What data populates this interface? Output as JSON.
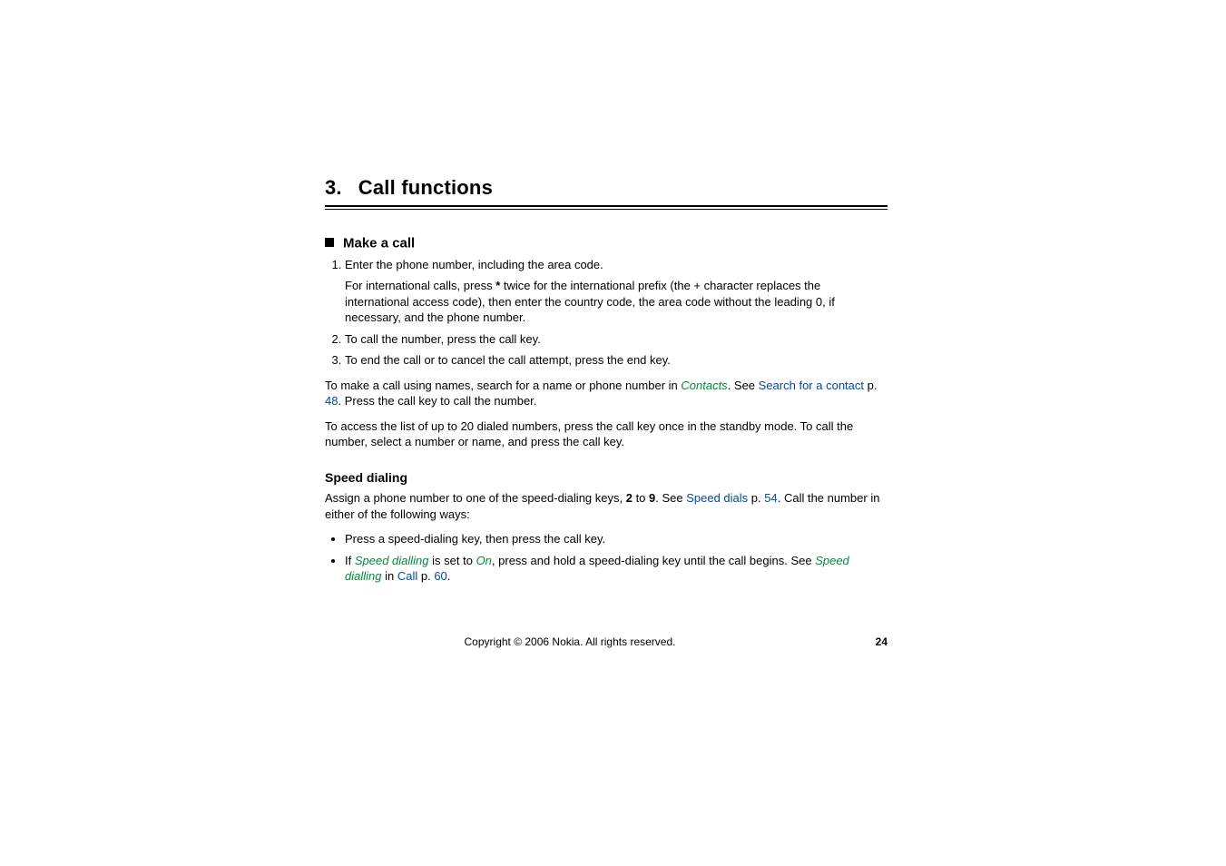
{
  "chapter": {
    "number": "3.",
    "title": "Call functions"
  },
  "section": {
    "title": "Make a call",
    "steps": [
      {
        "text": "Enter the phone number, including the area code.",
        "sub": "For international calls, press <span class='bold'>*</span> twice for the international prefix (the + character replaces the international access code), then enter the country code, the area code without the leading 0, if necessary, and the phone number."
      },
      {
        "text": "To call the number, press the call key."
      },
      {
        "text": "To end the call or to cancel the call attempt, press the end key."
      }
    ],
    "para1": "To make a call using names, search for a name or phone number in <span class='ui-ref'>Contacts</span>. See <span class='link'>Search for a contact</span> p. <span class='link'>48</span>. Press the call key to call the number.",
    "para2": "To access the list of up to 20 dialed numbers, press the call key once in the standby mode. To call the number, select a number or name, and press the call key."
  },
  "subsection": {
    "title": "Speed dialing",
    "intro": "Assign a phone number to one of the speed-dialing keys, <span class='bold'>2</span> to <span class='bold'>9</span>. See <span class='link'>Speed dials</span> p. <span class='link'>54</span>. Call the number in either of the following ways:",
    "bullets": [
      "Press a speed-dialing key, then press the call key.",
      "If <span class='ui-ref'>Speed dialling</span> is set to <span class='ui-ref'>On</span>, press and hold a speed-dialing key until the call begins. See <span class='ui-ref'>Speed dialling</span> in <span class='link'>Call</span> p. <span class='link'>60</span>."
    ]
  },
  "footer": {
    "copyright": "Copyright © 2006 Nokia. All rights reserved.",
    "pageNumber": "24"
  }
}
